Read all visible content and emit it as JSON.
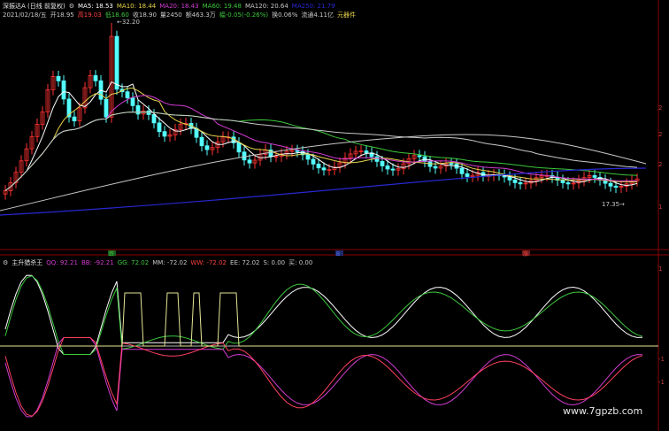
{
  "header": {
    "stock_name": "深振达A (日线 前复权)",
    "indicators": [
      {
        "label": "MA5: 18.53",
        "color": "#ffffff"
      },
      {
        "label": "MA10: 18.44",
        "color": "#e6d24a"
      },
      {
        "label": "MA20: 18.43",
        "color": "#d23cd2"
      },
      {
        "label": "MA60: 19.48",
        "color": "#3cc83c"
      },
      {
        "label": "MA120: 20.64",
        "color": "#c8c8c8"
      },
      {
        "label": "MA250: 21.79",
        "color": "#2828d2"
      }
    ],
    "ohlc_line": [
      {
        "label": "2021/02/18/五",
        "color": "#c8c8c8"
      },
      {
        "label": "开18.95",
        "color": "#c8c8c8"
      },
      {
        "label": "高19.03",
        "color": "#ff4040"
      },
      {
        "label": "低18.60",
        "color": "#3cc83c"
      },
      {
        "label": "收18.90",
        "color": "#c8c8c8"
      },
      {
        "label": "量2450",
        "color": "#c8c8c8"
      },
      {
        "label": "额463.3万",
        "color": "#c8c8c8"
      },
      {
        "label": "幅-0.05(-0.26%)",
        "color": "#3cc83c"
      },
      {
        "label": "换0.06%",
        "color": "#c8c8c8"
      },
      {
        "label": "流通4.11亿",
        "color": "#c8c8c8"
      },
      {
        "label": "元器件",
        "color": "#e6d24a"
      }
    ]
  },
  "sub_header": {
    "title": "主升猎杀王",
    "indicators": [
      {
        "label": "QQ: 92.21",
        "color": "#d23cd2"
      },
      {
        "label": "BB: -92.21",
        "color": "#d23cd2"
      },
      {
        "label": "GG: 72.02",
        "color": "#3cc83c"
      },
      {
        "label": "MM: -72.02",
        "color": "#c8c8c8"
      },
      {
        "label": "WW: -72.02",
        "color": "#ff4040"
      },
      {
        "label": "EE: 72.02",
        "color": "#c8c8c8"
      },
      {
        "label": "S: 0.00",
        "color": "#c8c8c8"
      },
      {
        "label": "买: 0.00",
        "color": "#c8c8c8"
      }
    ]
  },
  "annotations": {
    "high_label": "32.20",
    "low_label": "17.35",
    "markers": [
      {
        "text": "跌",
        "color": "#3cc83c",
        "bg": "#1e5a1e"
      },
      {
        "text": "B",
        "color": "#5a78ff",
        "bg": "#1e2a6e"
      },
      {
        "text": "涨",
        "color": "#ff4040",
        "bg": "#6e1e1e"
      }
    ]
  },
  "right_axis": {
    "main_ticks": [
      "2",
      "2",
      "2",
      "1"
    ],
    "sub_ticks": [
      "1",
      "-1",
      "-1"
    ]
  },
  "watermark": "www.7gpzb.com",
  "chart_data": {
    "type": "line",
    "title": "深振达A (日线 前复权)",
    "series": [
      {
        "name": "MA5",
        "values": [
          18.53
        ]
      },
      {
        "name": "MA10",
        "values": [
          18.44
        ]
      },
      {
        "name": "MA20",
        "values": [
          18.43
        ]
      },
      {
        "name": "MA60",
        "values": [
          19.48
        ]
      },
      {
        "name": "MA120",
        "values": [
          20.64
        ]
      },
      {
        "name": "MA250",
        "values": [
          21.79
        ]
      }
    ],
    "latest_bar": {
      "date": "2021/02/18",
      "open": 18.95,
      "high": 19.03,
      "low": 18.6,
      "close": 18.9,
      "volume": 2450
    },
    "marked_high": 32.2,
    "marked_low": 17.35,
    "oscillator": {
      "name": "主升猎杀王",
      "QQ": 92.21,
      "BB": -92.21,
      "GG": 72.02,
      "MM": -72.02,
      "WW": -72.02,
      "EE": 72.02,
      "S": 0.0,
      "买": 0.0
    }
  }
}
